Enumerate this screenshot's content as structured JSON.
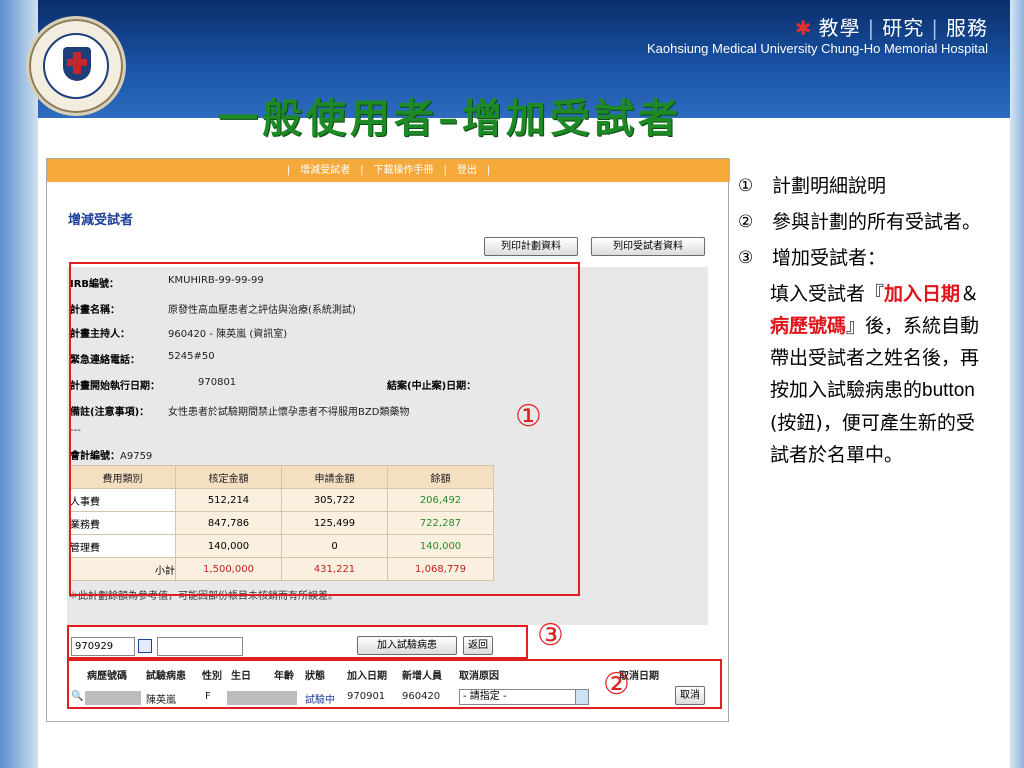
{
  "header": {
    "slogan": [
      "教學",
      "研究",
      "服務"
    ],
    "hospital": "Kaohsiung Medical University  Chung-Ho Memorial Hospital",
    "title": "一般使用者–增加受試者"
  },
  "screenshot": {
    "topbar": [
      "|",
      "增減受試者",
      "|",
      "下載操作手冊",
      "|",
      "登出",
      "|"
    ],
    "page_title": "增減受試者",
    "buttons": {
      "print_plan": "列印計劃資料",
      "print_subjects": "列印受試者資料"
    },
    "info": {
      "irb_label": "IRB編號：",
      "irb": "KMUHIRB-99-99-99",
      "name_label": "計畫名稱：",
      "name": "原發性高血壓患者之評估與治療(系統測試)",
      "pi_label": "計畫主持人：",
      "pi": "960420 - 陳英嵐 (資訊室)",
      "phone_label": "緊急連絡電話：",
      "phone": "5245#50",
      "start_label": "計畫開始執行日期：",
      "start": "970801",
      "end_label": "結案(中止案)日期：",
      "remarks_label": "備註(注意事項)：",
      "remarks": "女性患者於試驗期間禁止懷孕患者不得服用BZD類藥物",
      "dash": "---",
      "account_label": "會計編號：",
      "account": "A9759"
    },
    "budget": {
      "headers": [
        "費用類別",
        "核定金額",
        "申請金額",
        "餘額"
      ],
      "rows": [
        [
          "人事費",
          "512,214",
          "305,722",
          "206,492"
        ],
        [
          "業務費",
          "847,786",
          "125,499",
          "722,287"
        ],
        [
          "管理費",
          "140,000",
          "0",
          "140,000"
        ],
        [
          "小計",
          "1,500,000",
          "431,221",
          "1,068,779"
        ]
      ]
    },
    "budget_note": "＊此計劃餘額為參考值，可能因部份帳目未核銷而有所誤差。",
    "add_form": {
      "date_value": "970929",
      "add_button": "加入試驗病患",
      "back_button": "返回"
    },
    "subject_headers": [
      "病歷號碼",
      "試驗病患",
      "性別",
      "生日",
      "年齡",
      "狀態",
      "加入日期",
      "新增人員",
      "取消原因",
      "取消日期"
    ],
    "subject_row": {
      "name": "陳英嵐",
      "sex": "F",
      "status": "試驗中",
      "join_date": "970901",
      "added_by": "960420",
      "reason": "- 請指定 -",
      "cancel_button": "取消"
    },
    "markers": [
      "①",
      "③",
      "②"
    ]
  },
  "notes": {
    "items": [
      {
        "num": "①",
        "text": "計劃明細說明"
      },
      {
        "num": "②",
        "text": "參與計劃的所有受試者。"
      },
      {
        "num": "③",
        "text": "增加受試者："
      }
    ],
    "p3_a": "填入受試者『",
    "p3_hl1": "加入日期",
    "p3_amp": "＆",
    "p3_hl2": "病歷號碼",
    "p3_b": "』後，系統自動帶出受試者之姓名後，再按加入試驗病患的",
    "p3_lat": "button",
    "p3_c": " (按鈕)，便可產生新的受試者於名單中。"
  },
  "colors": {
    "title": "#1e8a26",
    "marker": "#e02020",
    "topbar": "#f5a93a",
    "header_bg": "#0a2e6b"
  }
}
